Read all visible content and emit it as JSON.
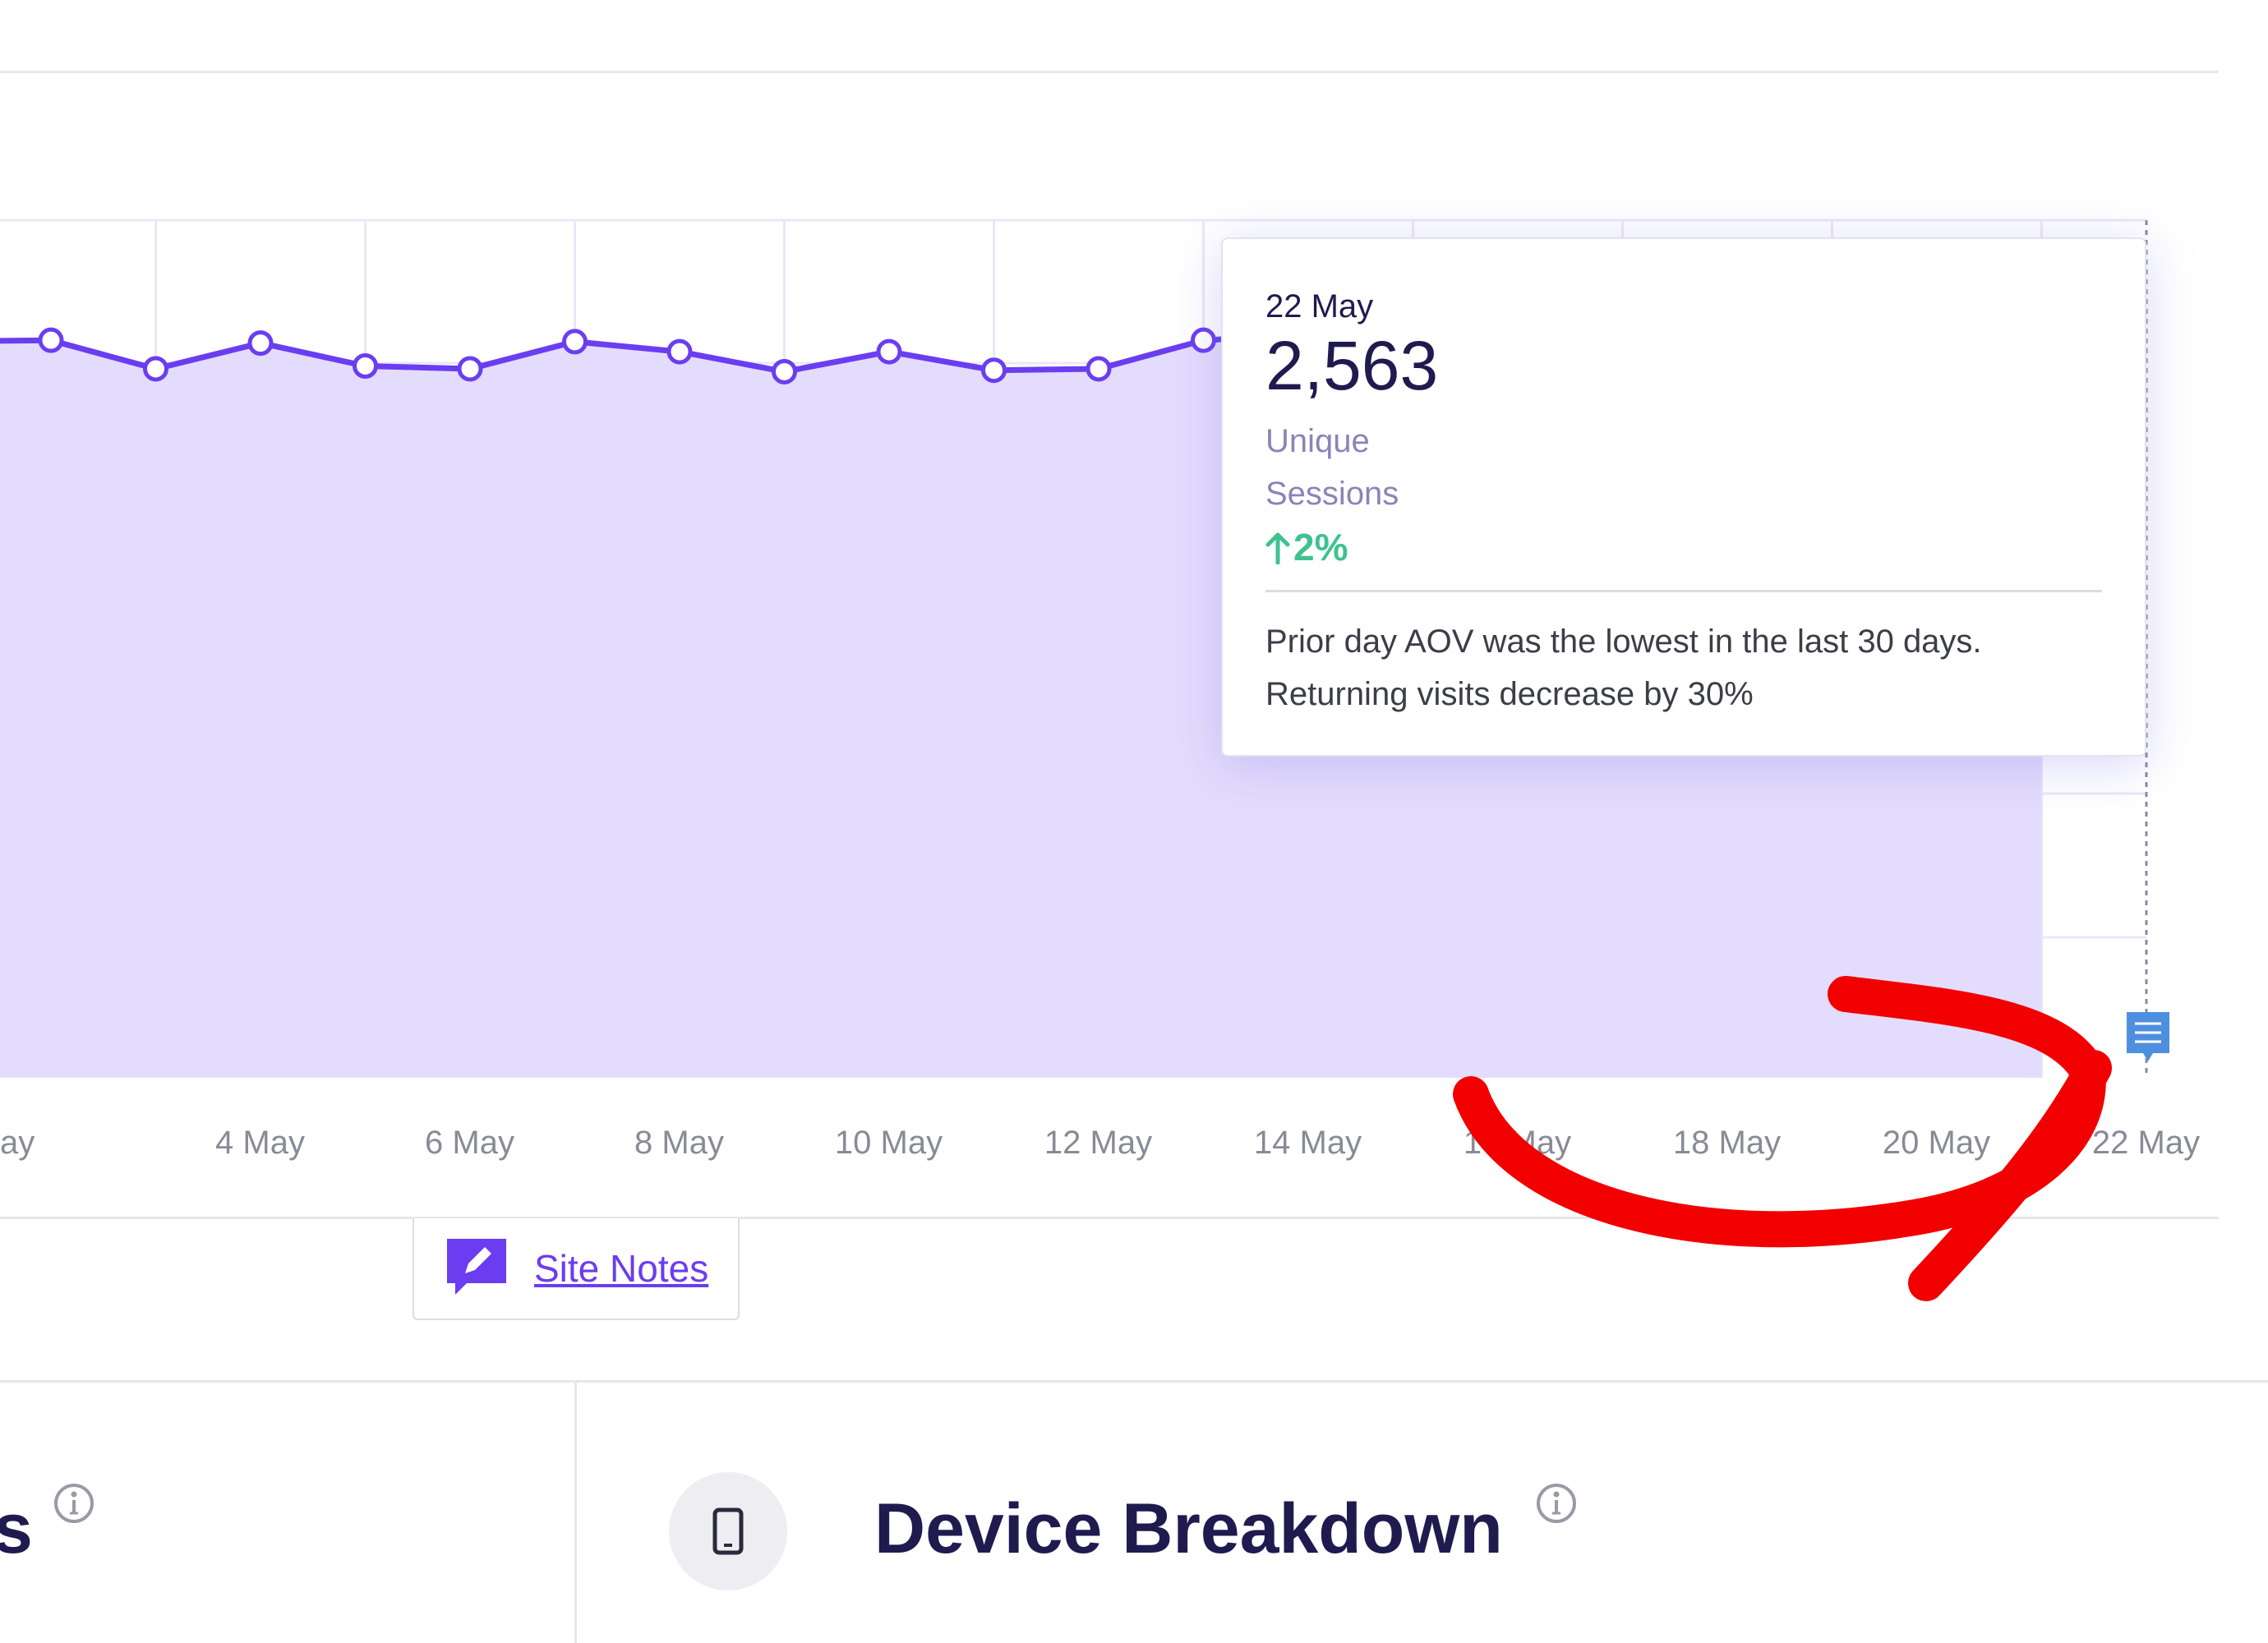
{
  "chart_data": {
    "type": "area",
    "x": [
      "3 May",
      "4 May",
      "5 May",
      "6 May",
      "7 May",
      "8 May",
      "9 May",
      "10 May",
      "11 May",
      "12 May",
      "13 May",
      "14 May",
      "15 May",
      "16 May",
      "17 May",
      "18 May",
      "19 May",
      "20 May",
      "21 May",
      "22 May"
    ],
    "series": [
      {
        "values": [
          2580,
          2480,
          2570,
          2490,
          2480,
          2575,
          2540,
          2470,
          2540,
          2475,
          2480,
          2580,
          2600,
          2590,
          2580,
          2570,
          2590,
          2580,
          2570,
          2563
        ]
      }
    ],
    "x_tick_labels": [
      "ay",
      "4 May",
      "6 May",
      "8 May",
      "10 May",
      "12 May",
      "14 May",
      "16 May",
      "18 May",
      "20 May",
      "22 May"
    ],
    "ylim": [
      0,
      3000
    ],
    "grid": true,
    "colors": {
      "line": "#6a3ef0",
      "fill": "#e4dcfc",
      "grid": "#ebe7f7",
      "point_fill": "#ffffff"
    }
  },
  "tooltip": {
    "date": "22 May",
    "value": "2,563",
    "label": "Unique Sessions",
    "change": "2%",
    "change_color": "#3fc28f",
    "notes": "Prior day AOV was the lowest in the last 30 days. Returning visits decrease by 30%"
  },
  "site_notes": {
    "label": "Site Notes",
    "icon": "pencil-chat-icon",
    "color": "#6b3cf0"
  },
  "sections": [
    {
      "title": "s",
      "icon": "info-icon"
    },
    {
      "title": "Device Breakdown",
      "icon": "mobile-phone-icon",
      "info_icon": "info-icon"
    }
  ],
  "annotation": {
    "icon": "curved-arrow",
    "color": "#f20000"
  }
}
